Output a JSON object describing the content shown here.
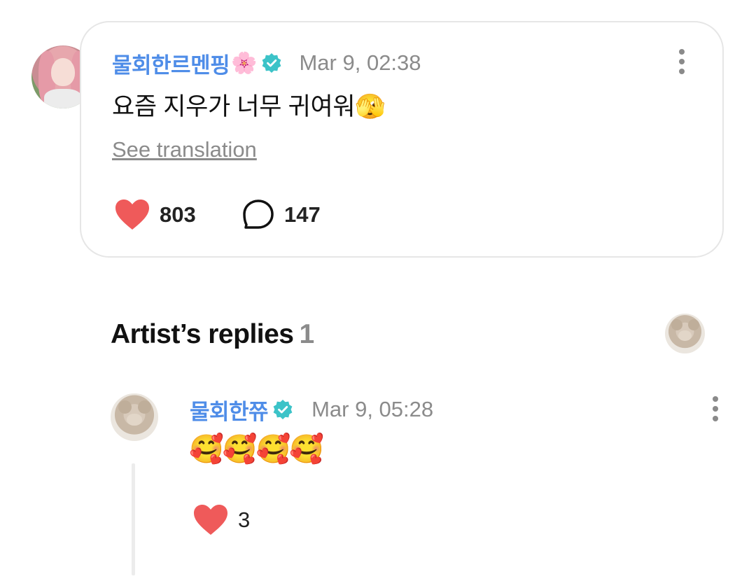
{
  "comment": {
    "author": "물회한르멘핑",
    "author_emoji": "🌸",
    "timestamp": "Mar 9, 02:38",
    "text": "요즘 지우가 너무 귀여워🫣",
    "see_translation": "See translation",
    "likes": "803",
    "replies": "147"
  },
  "artist_replies": {
    "title": "Artist’s replies",
    "count": "1",
    "reply": {
      "author": "물회한쮸",
      "timestamp": "Mar 9, 05:28",
      "text": "🥰🥰🥰🥰",
      "likes": "3"
    }
  },
  "colors": {
    "author_name": "#4f8de8",
    "verified_badge": "#3cc3c8",
    "like_heart": "#ef5a5a",
    "muted_text": "#8b8b8b"
  },
  "icons": {
    "verified": "verified-badge-icon",
    "like": "heart-icon",
    "reply": "speech-bubble-icon",
    "more": "more-vertical-icon"
  }
}
